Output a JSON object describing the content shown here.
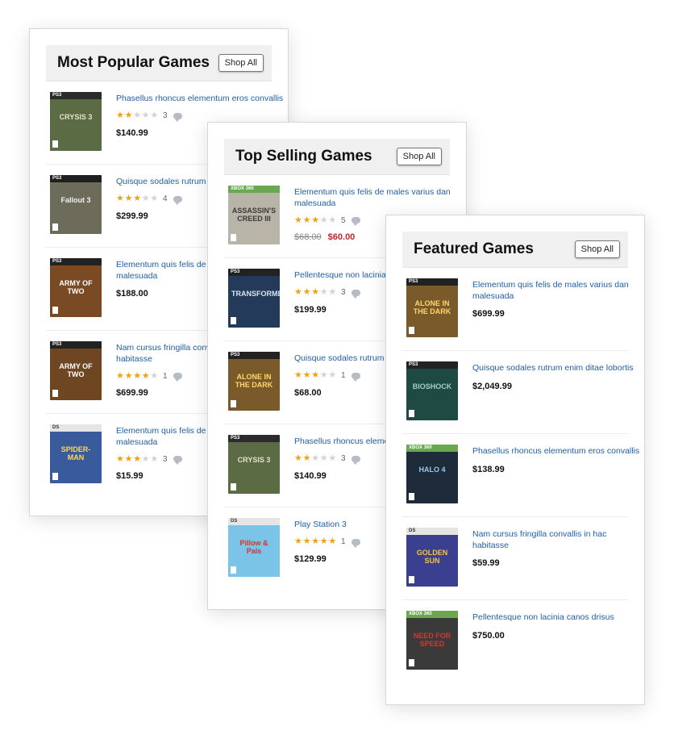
{
  "panels": [
    {
      "title": "Most Popular Games",
      "button": "Shop All",
      "items": [
        {
          "title_lines": [
            "Phasellus rhoncus elementum eros convallis",
            ""
          ],
          "stars": 2,
          "reviews": "3",
          "price": "$140.99",
          "old_price": "",
          "cover": {
            "bg": "#5b6b44",
            "band": "PS3",
            "band_color": "#2b2b2b",
            "logo": "CRYSIS 3",
            "logo_color": "#e8e0c8"
          }
        },
        {
          "title_lines": [
            "Quisque sodales rutrum enim",
            ""
          ],
          "stars": 3.5,
          "reviews": "4",
          "price": "$299.99",
          "old_price": "",
          "cover": {
            "bg": "#6d6b5a",
            "band": "PS3",
            "band_color": "#1f1f1f",
            "logo": "Fallout 3",
            "logo_color": "#f2f2f2"
          }
        },
        {
          "title_lines": [
            "Elementum quis felis de males",
            "malesuada"
          ],
          "stars": 0,
          "reviews": "",
          "price": "$188.00",
          "old_price": "",
          "cover": {
            "bg": "#7a4a24",
            "band": "PS3",
            "band_color": "#222",
            "logo": "ARMY OF TWO",
            "logo_color": "#ffffff"
          }
        },
        {
          "title_lines": [
            "Nam cursus fringilla convallis",
            "habitasse"
          ],
          "stars": 4,
          "reviews": "1",
          "price": "$699.99",
          "old_price": "",
          "cover": {
            "bg": "#6e4622",
            "band": "PS3",
            "band_color": "#222",
            "logo": "ARMY OF TWO",
            "logo_color": "#ffffff"
          }
        },
        {
          "title_lines": [
            "Elementum quis felis de males",
            "malesuada"
          ],
          "stars": 3,
          "reviews": "3",
          "price": "$15.99",
          "old_price": "",
          "cover": {
            "bg": "#3a5b9b",
            "band": "DS",
            "band_color": "#e5e5e5",
            "logo": "SPIDER-MAN",
            "logo_color": "#ffdc4a"
          }
        }
      ]
    },
    {
      "title": "Top Selling Games",
      "button": "Shop All",
      "items": [
        {
          "title_lines": [
            "Elementum quis felis de males varius dan",
            "malesuada"
          ],
          "stars": 3.5,
          "reviews": "5",
          "price": "$60.00",
          "old_price": "$68.00",
          "cover": {
            "bg": "#b9b4a8",
            "band": "XBOX 360",
            "band_color": "#6aa84f",
            "logo": "ASSASSIN'S CREED III",
            "logo_color": "#3a3a3a"
          }
        },
        {
          "title_lines": [
            "Pellentesque non lacinia car",
            ""
          ],
          "stars": 3.5,
          "reviews": "3",
          "price": "$199.99",
          "old_price": "",
          "cover": {
            "bg": "#243a5a",
            "band": "PS3",
            "band_color": "#222",
            "logo": "TRANSFORMERS",
            "logo_color": "#d7e3f0"
          }
        },
        {
          "title_lines": [
            "Quisque sodales rutrum enim",
            ""
          ],
          "stars": 3.5,
          "reviews": "1",
          "price": "$68.00",
          "old_price": "",
          "cover": {
            "bg": "#7a5a2a",
            "band": "PS3",
            "band_color": "#222",
            "logo": "ALONE IN THE DARK",
            "logo_color": "#ffd66b"
          }
        },
        {
          "title_lines": [
            "Phasellus rhoncus elementum",
            ""
          ],
          "stars": 2,
          "reviews": "3",
          "price": "$140.99",
          "old_price": "",
          "cover": {
            "bg": "#5b6b44",
            "band": "PS3",
            "band_color": "#2b2b2b",
            "logo": "CRYSIS 3",
            "logo_color": "#e8e0c8"
          }
        },
        {
          "title_lines": [
            "Play Station 3",
            ""
          ],
          "stars": 5,
          "reviews": "1",
          "price": "$129.99",
          "old_price": "",
          "cover": {
            "bg": "#7cc3e8",
            "band": "DS",
            "band_color": "#e5e5e5",
            "logo": "Pillow & Pals",
            "logo_color": "#d2352b"
          }
        }
      ]
    },
    {
      "title": "Featured Games",
      "button": "Shop All",
      "items": [
        {
          "title_lines": [
            "Elementum quis felis de males varius dan",
            "malesuada"
          ],
          "stars": 0,
          "reviews": "",
          "price": "$699.99",
          "old_price": "",
          "cover": {
            "bg": "#7a5a2a",
            "band": "PS3",
            "band_color": "#222",
            "logo": "ALONE IN THE DARK",
            "logo_color": "#ffd66b"
          }
        },
        {
          "title_lines": [
            "Quisque sodales rutrum enim ditae lobortis",
            ""
          ],
          "stars": 0,
          "reviews": "",
          "price": "$2,049.99",
          "old_price": "",
          "cover": {
            "bg": "#1f4a44",
            "band": "PS3",
            "band_color": "#222",
            "logo": "BIOSHOCK",
            "logo_color": "#9fd0c0"
          }
        },
        {
          "title_lines": [
            "Phasellus rhoncus elementum eros convallis",
            ""
          ],
          "stars": 0,
          "reviews": "",
          "price": "$138.99",
          "old_price": "",
          "cover": {
            "bg": "#1d2b3a",
            "band": "XBOX 360",
            "band_color": "#6aa84f",
            "logo": "HALO 4",
            "logo_color": "#9cc7e6"
          }
        },
        {
          "title_lines": [
            "Nam cursus fringilla convallis in hac",
            "habitasse"
          ],
          "stars": 0,
          "reviews": "",
          "price": "$59.99",
          "old_price": "",
          "cover": {
            "bg": "#3b3f8f",
            "band": "DS",
            "band_color": "#e5e5e5",
            "logo": "GOLDEN SUN",
            "logo_color": "#f5c542"
          }
        },
        {
          "title_lines": [
            "Pellentesque non lacinia canos drisus",
            ""
          ],
          "stars": 0,
          "reviews": "",
          "price": "$750.00",
          "old_price": "",
          "cover": {
            "bg": "#3a3a3a",
            "band": "XBOX 360",
            "band_color": "#6aa84f",
            "logo": "NEED FOR SPEED",
            "logo_color": "#e0322c"
          }
        }
      ]
    }
  ]
}
